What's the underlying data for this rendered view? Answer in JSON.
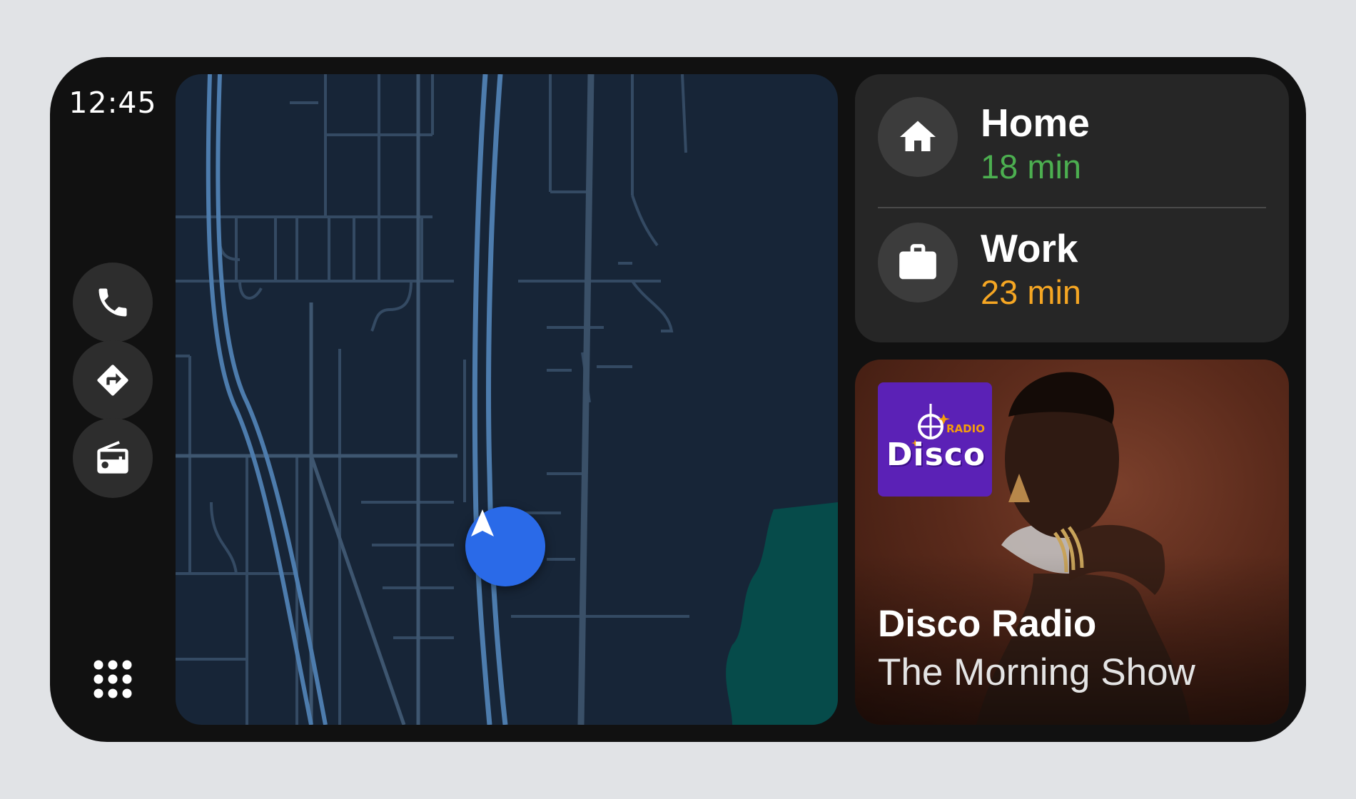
{
  "status": {
    "time": "12:45"
  },
  "rail": {
    "items": [
      {
        "id": "phone",
        "icon": "phone-icon"
      },
      {
        "id": "navigation",
        "icon": "directions-icon"
      },
      {
        "id": "media",
        "icon": "radio-icon"
      }
    ],
    "apps_icon": "app-grid-icon"
  },
  "map": {
    "puck_icon": "navigation-arrow-icon",
    "colors": {
      "background": "#172537",
      "streets": "#344a63",
      "highway": "#4d7cad",
      "water": "#064b4a",
      "puck": "#2a6ae8"
    }
  },
  "destinations": [
    {
      "name": "Home",
      "eta": "18 min",
      "eta_color": "#4caf50",
      "icon": "home-icon"
    },
    {
      "name": "Work",
      "eta": "23 min",
      "eta_color": "#f5a623",
      "icon": "briefcase-icon"
    }
  ],
  "media": {
    "station_logo": {
      "top_text": "RADIO",
      "main_text": "Disco",
      "color": "#5b21b6"
    },
    "title": "Disco Radio",
    "subtitle": "The Morning Show"
  }
}
